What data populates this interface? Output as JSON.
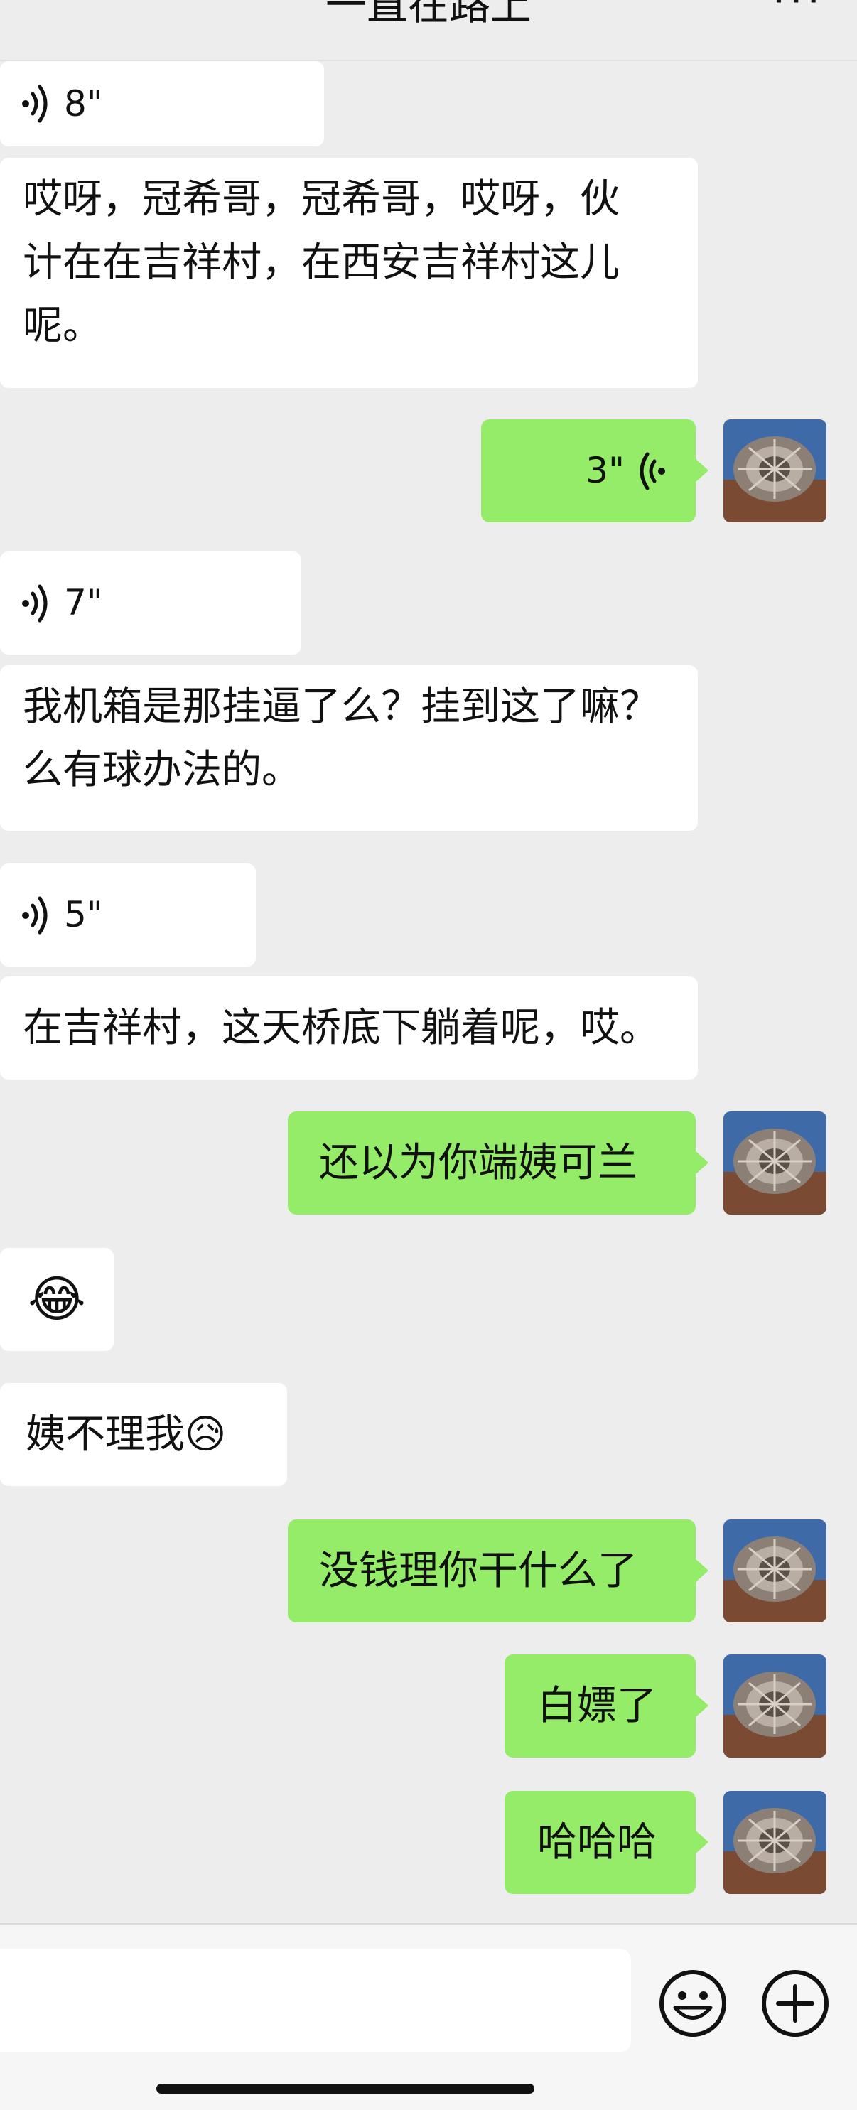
{
  "header": {
    "title": "一直在路上",
    "more": "···"
  },
  "messages": [
    {
      "side": "left",
      "type": "voice",
      "duration": "8\""
    },
    {
      "side": "left",
      "type": "text",
      "lines": [
        "哎呀，冠希哥，冠希哥，哎呀，伙",
        "计在在吉祥村，在西安吉祥村这儿",
        "呢。"
      ]
    },
    {
      "side": "right",
      "type": "voice",
      "duration": "3\""
    },
    {
      "side": "left",
      "type": "voice",
      "duration": "7\""
    },
    {
      "side": "left",
      "type": "text",
      "lines": [
        "我机箱是那挂逼了么？挂到这了嘛？",
        "么有球办法的。"
      ]
    },
    {
      "side": "left",
      "type": "voice",
      "duration": "5\""
    },
    {
      "side": "left",
      "type": "text",
      "lines": [
        "在吉祥村，这天桥底下躺着呢，哎。"
      ]
    },
    {
      "side": "right",
      "type": "text",
      "text": "还以为你端姨可兰"
    },
    {
      "side": "left",
      "type": "emoji",
      "text": "😂"
    },
    {
      "side": "left",
      "type": "text",
      "text": "姨不理我😥"
    },
    {
      "side": "right",
      "type": "text",
      "text": "没钱理你干什么了"
    },
    {
      "side": "right",
      "type": "text",
      "text": "白嫖了"
    },
    {
      "side": "right",
      "type": "text",
      "text": "哈哈哈"
    }
  ],
  "input": {
    "value": "",
    "emoji_icon": "smiley-icon",
    "plus_icon": "plus-icon"
  },
  "colors": {
    "background": "#ededed",
    "self_bubble": "#95ec69",
    "other_bubble": "#ffffff"
  }
}
